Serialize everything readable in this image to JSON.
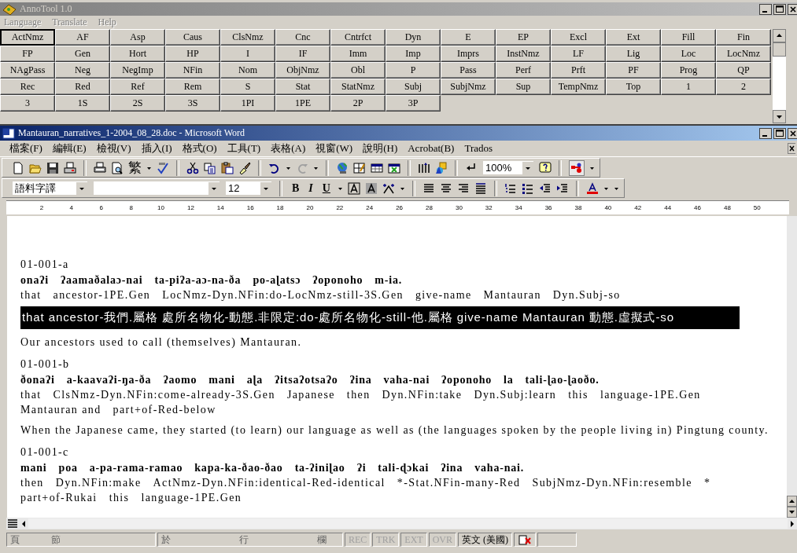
{
  "annotool": {
    "title": "AnnoTool 1.0",
    "menu": [
      {
        "label": "Language",
        "disabled": true
      },
      {
        "label": "Translate",
        "disabled": true
      },
      {
        "label": "Help",
        "disabled": true
      }
    ],
    "button_rows": [
      [
        {
          "label": "ActNmz",
          "selected": true
        },
        {
          "label": "AF",
          "selected": false
        },
        {
          "label": "Asp",
          "selected": false
        },
        {
          "label": "Caus",
          "selected": false
        },
        {
          "label": "ClsNmz",
          "selected": false
        },
        {
          "label": "Cnc",
          "selected": false
        },
        {
          "label": "Cntrfct",
          "selected": false
        },
        {
          "label": "Dyn",
          "selected": false
        },
        {
          "label": "E",
          "selected": false
        },
        {
          "label": "EP",
          "selected": false
        },
        {
          "label": "Excl",
          "selected": false
        },
        {
          "label": "Ext",
          "selected": false
        },
        {
          "label": "Fill",
          "selected": false
        },
        {
          "label": "Fin",
          "selected": false
        }
      ],
      [
        {
          "label": "FP",
          "selected": false
        },
        {
          "label": "Gen",
          "selected": false
        },
        {
          "label": "Hort",
          "selected": false
        },
        {
          "label": "HP",
          "selected": false
        },
        {
          "label": "I",
          "selected": false
        },
        {
          "label": "IF",
          "selected": false
        },
        {
          "label": "Imm",
          "selected": false
        },
        {
          "label": "Imp",
          "selected": false
        },
        {
          "label": "Imprs",
          "selected": false
        },
        {
          "label": "InstNmz",
          "selected": false
        },
        {
          "label": "LF",
          "selected": false
        },
        {
          "label": "Lig",
          "selected": false
        },
        {
          "label": "Loc",
          "selected": false
        },
        {
          "label": "LocNmz",
          "selected": false
        }
      ],
      [
        {
          "label": "NAgPass",
          "selected": false
        },
        {
          "label": "Neg",
          "selected": false
        },
        {
          "label": "NegImp",
          "selected": false
        },
        {
          "label": "NFin",
          "selected": false
        },
        {
          "label": "Nom",
          "selected": false
        },
        {
          "label": "ObjNmz",
          "selected": false
        },
        {
          "label": "Obl",
          "selected": false
        },
        {
          "label": "P",
          "selected": false
        },
        {
          "label": "Pass",
          "selected": false
        },
        {
          "label": "Perf",
          "selected": false
        },
        {
          "label": "Prft",
          "selected": false
        },
        {
          "label": "PF",
          "selected": false
        },
        {
          "label": "Prog",
          "selected": false
        },
        {
          "label": "QP",
          "selected": false
        }
      ],
      [
        {
          "label": "Rec",
          "selected": false
        },
        {
          "label": "Red",
          "selected": false
        },
        {
          "label": "Ref",
          "selected": false
        },
        {
          "label": "Rem",
          "selected": false
        },
        {
          "label": "S",
          "selected": false
        },
        {
          "label": "Stat",
          "selected": false
        },
        {
          "label": "StatNmz",
          "selected": false
        },
        {
          "label": "Subj",
          "selected": false
        },
        {
          "label": "SubjNmz",
          "selected": false
        },
        {
          "label": "Sup",
          "selected": false
        },
        {
          "label": "TempNmz",
          "selected": false
        },
        {
          "label": "Top",
          "selected": false
        },
        {
          "label": "1",
          "selected": false
        },
        {
          "label": "2",
          "selected": false
        }
      ],
      [
        {
          "label": "3",
          "selected": false
        },
        {
          "label": "1S",
          "selected": false
        },
        {
          "label": "2S",
          "selected": false
        },
        {
          "label": "3S",
          "selected": false
        },
        {
          "label": "1PI",
          "selected": false
        },
        {
          "label": "1PE",
          "selected": false
        },
        {
          "label": "2P",
          "selected": false
        },
        {
          "label": "3P",
          "selected": false
        }
      ]
    ]
  },
  "word": {
    "title": "Mantauran_narratives_1-2004_08_28.doc - Microsoft Word",
    "menu": [
      "檔案(F)",
      "編輯(E)",
      "檢視(V)",
      "插入(I)",
      "格式(O)",
      "工具(T)",
      "表格(A)",
      "視窗(W)",
      "說明(H)",
      "Acrobat(B)",
      "Trados"
    ],
    "toolbar": {
      "convert_button": "繁",
      "zoom": "100%"
    },
    "formatting": {
      "style": "語料字譯",
      "font_size": "12",
      "bold": "B",
      "italic": "I",
      "underline": "U"
    },
    "ruler": [
      "2",
      "4",
      "6",
      "8",
      "10",
      "12",
      "14",
      "16",
      "18",
      "20",
      "22",
      "24",
      "26",
      "28",
      "30",
      "32",
      "34",
      "36",
      "38",
      "40",
      "42",
      "44",
      "46",
      "48",
      "50"
    ],
    "document": [
      {
        "kind": "label",
        "text": "01-001-a"
      },
      {
        "kind": "source",
        "words": [
          "onaʔi",
          "ʔaamaðalaɔ-nai",
          "ta-piʔa-aɔ-na-ða",
          "po-aɭatsɔ",
          "ʔoponoho",
          "m-ia."
        ]
      },
      {
        "kind": "gloss",
        "words": [
          "that",
          "ancestor-1PE.Gen",
          "LocNmz-Dyn.NFin:do-LocNmz-still-3S.Gen",
          "give-name",
          "Mantauran",
          "Dyn.Subj-so"
        ]
      },
      {
        "kind": "highlight",
        "text": "that ancestor-我們.屬格 處所名物化-動態.非限定:do-處所名物化-still-他.屬格 give-name Mantauran 動態.虛擬式-so"
      },
      {
        "kind": "translation",
        "text": "Our ancestors used to call (themselves) Mantauran."
      },
      {
        "kind": "label",
        "text": "01-001-b"
      },
      {
        "kind": "source",
        "words": [
          "ðonaʔi",
          "a-kaavaʔi-ŋa-ða",
          "ʔaomo",
          "mani",
          "aɭa",
          "ʔitsaʔotsaʔo",
          "ʔina",
          "vaha-nai",
          "ʔoponoho",
          "la",
          "tali-ɭao-ɭaoðo."
        ]
      },
      {
        "kind": "gloss",
        "words": [
          "that",
          "ClsNmz-Dyn.NFin:come-already-3S.Gen",
          "Japanese",
          "then",
          "Dyn.NFin:take",
          "Dyn.Subj:learn",
          "this",
          "language-1PE.Gen",
          "Mantauran and",
          "part+of-Red-below"
        ]
      },
      {
        "kind": "translation",
        "text": "When the Japanese came, they started (to learn) our language as well as (the languages spoken by the people living in) Pingtung county."
      },
      {
        "kind": "label",
        "text": "01-001-c"
      },
      {
        "kind": "source",
        "words": [
          "mani",
          "poa",
          "a-pa-rama-ramao",
          "kapa-ka-ðao-ðao",
          "ta-ʔiniɭao",
          "ʔi",
          "tali-ɖɔkai",
          "ʔina",
          "vaha-nai."
        ]
      },
      {
        "kind": "gloss",
        "words": [
          "then",
          "Dyn.NFin:make",
          "ActNmz-Dyn.NFin:identical-Red-identical",
          "*-Stat.NFin-many-Red",
          "SubjNmz-Dyn.NFin:resemble",
          "*",
          "part+of-Rukai",
          "this",
          "language-1PE.Gen"
        ]
      }
    ]
  },
  "status_bar": {
    "page": "頁",
    "section": "節",
    "at": "於",
    "line": "行",
    "column": "欄",
    "modes": [
      {
        "label": "REC",
        "disabled": true
      },
      {
        "label": "TRK",
        "disabled": true
      },
      {
        "label": "EXT",
        "disabled": true
      },
      {
        "label": "OVR",
        "disabled": true
      }
    ],
    "language": "英文 (美國)"
  }
}
